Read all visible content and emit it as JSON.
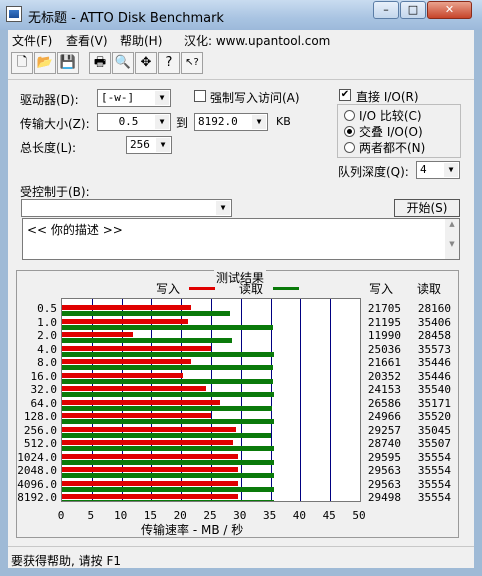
{
  "window": {
    "title": "无标题 - ATTO Disk Benchmark",
    "min_glyph": "–",
    "max_glyph": "□",
    "close_glyph": "✕"
  },
  "menu": {
    "file": "文件(F)",
    "view": "查看(V)",
    "help": "帮助(H)",
    "localized": "汉化: www.upantool.com"
  },
  "toolbar": {
    "icons": [
      "new-document-icon",
      "open-folder-icon",
      "save-icon",
      "print-icon",
      "print-preview-icon",
      "move-icon",
      "help-icon",
      "context-help-icon"
    ],
    "glyphs": [
      "🗋",
      "📂",
      "💾",
      "🖶",
      "🔍",
      "✥",
      "?",
      "↖?"
    ]
  },
  "settings": {
    "drive_label": "驱动器(D):",
    "drive_value": "[-w-]",
    "force_write_label": "强制写入访问(A)",
    "force_write_checked": false,
    "transfer_label": "传输大小(Z):",
    "transfer_from": "0.5",
    "to_label": "到",
    "transfer_to": "8192.0",
    "kb_label": "KB",
    "total_label": "总长度(L):",
    "total_value": "256 MB",
    "direct_io_label": "直接 I/O(R)",
    "direct_io_checked": true,
    "io_compare_label": "I/O 比较(C)",
    "overlapped_io_label": "交叠 I/O(O)",
    "neither_label": "两者都不(N)",
    "selected_mode": "overlapped",
    "queue_label": "队列深度(Q):",
    "queue_value": "4",
    "controlled_by_label": "受控制于(B):",
    "controlled_by_value": "",
    "start_button": "开始(S)",
    "description": "<<  你的描述  >>"
  },
  "results": {
    "title": "测试结果",
    "write_legend": "写入",
    "read_legend": "读取",
    "write_column": "写入",
    "read_column": "读取",
    "xlabel": "传输速率 - MB / 秒"
  },
  "chart_data": {
    "type": "bar",
    "orientation": "horizontal",
    "title": "测试结果",
    "xlabel": "传输速率 - MB / 秒",
    "xlim": [
      0,
      50
    ],
    "xticks": [
      "0",
      "5",
      "10",
      "15",
      "20",
      "25",
      "30",
      "35",
      "40",
      "45",
      "50"
    ],
    "categories": [
      "0.5",
      "1.0",
      "2.0",
      "4.0",
      "8.0",
      "16.0",
      "32.0",
      "64.0",
      "128.0",
      "256.0",
      "512.0",
      "1024.0",
      "2048.0",
      "4096.0",
      "8192.0"
    ],
    "series": [
      {
        "name": "写入",
        "color": "#e00000",
        "values": [
          21.7,
          21.2,
          11.99,
          25.04,
          21.66,
          20.35,
          24.15,
          26.59,
          24.97,
          29.26,
          28.74,
          29.6,
          29.56,
          29.56,
          29.5
        ],
        "labels": [
          "21705",
          "21195",
          "11990",
          "25036",
          "21661",
          "20352",
          "24153",
          "26586",
          "24966",
          "29257",
          "28740",
          "29595",
          "29563",
          "29563",
          "29498"
        ]
      },
      {
        "name": "读取",
        "color": "#0a7a0a",
        "values": [
          28.16,
          35.41,
          28.46,
          35.57,
          35.45,
          35.45,
          35.54,
          35.17,
          35.52,
          35.05,
          35.51,
          35.55,
          35.55,
          35.55,
          35.55
        ],
        "labels": [
          "28160",
          "35406",
          "28458",
          "35573",
          "35446",
          "35446",
          "35540",
          "35171",
          "35520",
          "35045",
          "35507",
          "35554",
          "35554",
          "35554",
          "35554"
        ]
      }
    ]
  },
  "status": {
    "text": "要获得帮助, 请按 F1"
  }
}
